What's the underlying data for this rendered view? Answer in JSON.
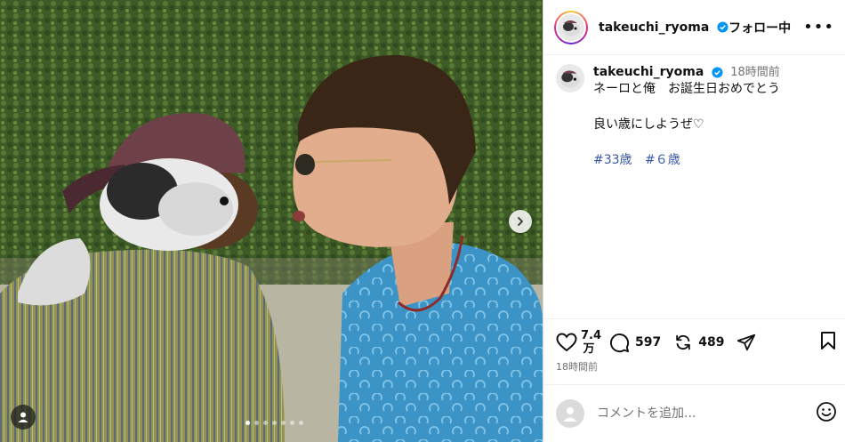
{
  "post": {
    "username": "takeuchi_ryoma",
    "follow_label": "フォロー中",
    "more_label": "•••",
    "caption_time": "18時間前",
    "caption_line1": "ネーロと俺　お誕生日おめでとう",
    "caption_line2": "良い歳にしようぜ♡",
    "hashtags": [
      "#33歳",
      "#６歳"
    ],
    "likes_line1": "7.4",
    "likes_line2": "万",
    "comments_count": "597",
    "reposts_count": "489",
    "posted_time": "18時間前",
    "comment_placeholder": "コメントを追加..."
  },
  "carousel": {
    "total": 7,
    "active_index": 0
  },
  "icons": {
    "verified": "verified-badge-icon",
    "like": "heart-icon",
    "comment": "comment-bubble-icon",
    "repost": "repost-icon",
    "share": "paper-plane-icon",
    "save": "bookmark-icon",
    "next": "chevron-right-icon",
    "user_tag": "user-tag-icon",
    "emoji": "smiley-icon"
  },
  "colors": {
    "verified": "#0095f6",
    "hashtag": "#3a58a8",
    "muted": "#737373"
  }
}
